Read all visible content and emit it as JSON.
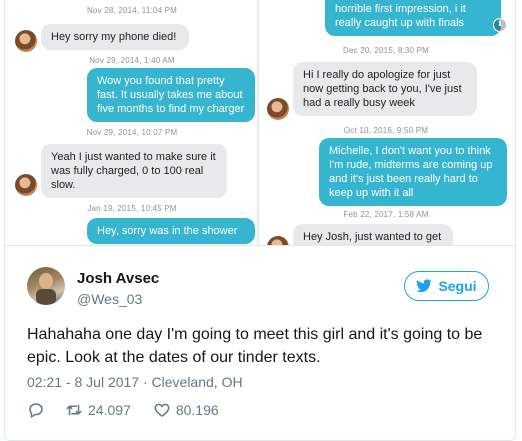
{
  "chat": {
    "left": {
      "ts1": "Nov 28, 2014, 11:04 PM",
      "msg1": "Hey sorry my phone died!",
      "ts2": "Nov 29, 2014, 1:40 AM",
      "msg2": "Wow you found that pretty fast. It usually takes me about  five months to find my charger",
      "ts3": "Nov 29, 2014, 10:07 PM",
      "msg3": "Yeah I just wanted to make sure it was fully charged, 0 to 100 real slow.",
      "ts4": "Jan 19, 2015, 10:45 PM",
      "msg4": "Hey, sorry was in the shower"
    },
    "right": {
      "msg0": "horrible first impression, i it really caught up with finals",
      "ts1": "Dec 20, 2015, 8:30 PM",
      "msg1": "Hi I really do apologize for just now getting back to you, I've just had a really busy week",
      "ts2": "Oct 10, 2016, 9:50 PM",
      "msg2": "Michelle, I don't want you to think I'm rude, midterms are coming up and it's just been really hard to keep up with it all",
      "ts3": "Feb 22, 2017, 1:58 AM",
      "msg3": "Hey Josh, just wanted to get back to you really quickly!"
    },
    "colors": {
      "outgoing": "#36b5d0",
      "incoming": "#e9e9eb"
    },
    "info_icon": "info-icon"
  },
  "tweet": {
    "name": "Josh Avsec",
    "handle": "@Wes_03",
    "follow_label": "Segui",
    "text": "Hahahaha one day I'm going to meet this girl and it's going to be epic. Look at the dates of our tinder texts.",
    "meta": "02:21 - 8 Jul 2017 · Cleveland, OH",
    "retweets": "24.097",
    "likes": "80.196",
    "icons": [
      "reply-icon",
      "retweet-icon",
      "heart-icon",
      "bird-icon"
    ],
    "accent": "#1da1f2"
  }
}
